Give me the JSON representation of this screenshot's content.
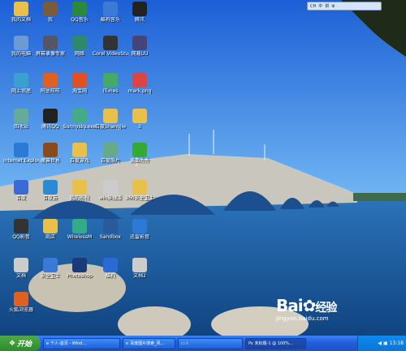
{
  "desktop_icons": [
    {
      "label": "我的文档",
      "glyph": "folder-icon",
      "color": "#e8c04a"
    },
    {
      "label": "我",
      "glyph": "person-icon",
      "color": "#7a5b3a"
    },
    {
      "label": "QQ音乐",
      "glyph": "music-icon",
      "color": "#2a8a3a"
    },
    {
      "label": "酷狗音乐",
      "glyph": "dog-icon",
      "color": "#3b7ad6"
    },
    {
      "label": "腾讯",
      "glyph": "penguin-icon",
      "color": "#222"
    },
    {
      "label": "我的电脑",
      "glyph": "computer-icon",
      "color": "#6b9ad6"
    },
    {
      "label": "屏幕录像专家",
      "glyph": "recorder-icon",
      "color": "#556"
    },
    {
      "label": "网络",
      "glyph": "network-icon",
      "color": "#2a8a6a"
    },
    {
      "label": "Corel VideoStudio",
      "glyph": "video-icon",
      "color": "#333"
    },
    {
      "label": "网易UU",
      "glyph": "game-icon",
      "color": "#447"
    },
    {
      "label": "网上邻居",
      "glyph": "globe-icon",
      "color": "#3aa0d0"
    },
    {
      "label": "阿里旺旺",
      "glyph": "chat-icon",
      "color": "#e06020"
    },
    {
      "label": "淘宝网",
      "glyph": "shop-icon",
      "color": "#e05020"
    },
    {
      "label": "iTunes",
      "glyph": "itunes-icon",
      "color": "#4a6"
    },
    {
      "label": "mark.png",
      "glyph": "image-icon",
      "color": "#d44"
    },
    {
      "label": "回收站",
      "glyph": "recycle-icon",
      "color": "#6a9"
    },
    {
      "label": "腾讯QQ",
      "glyph": "qq-icon",
      "color": "#222"
    },
    {
      "label": "Sunnysky.exe",
      "glyph": "app-icon",
      "color": "#4a8"
    },
    {
      "label": "百度Shangjie",
      "glyph": "folder-icon",
      "color": "#e8c04a"
    },
    {
      "label": "3",
      "glyph": "folder-icon",
      "color": "#e8c04a"
    },
    {
      "label": "Internet Explorer",
      "glyph": "ie-icon",
      "color": "#2a7ad6"
    },
    {
      "label": "魔兽世界",
      "glyph": "warcraft-icon",
      "color": "#8a4a1a"
    },
    {
      "label": "百度游戏",
      "glyph": "folder-icon",
      "color": "#e8c04a"
    },
    {
      "label": "百度照片",
      "glyph": "photo-icon",
      "color": "#6a8"
    },
    {
      "label": "美图秀秀",
      "glyph": "pen-icon",
      "color": "#3a3"
    },
    {
      "label": "百度",
      "glyph": "baidu-icon",
      "color": "#3a6ad6"
    },
    {
      "label": "百度云",
      "glyph": "cloud-icon",
      "color": "#2a8ad6"
    },
    {
      "label": "我的影视",
      "glyph": "folder-icon",
      "color": "#e8c04a"
    },
    {
      "label": "win旗舰版",
      "glyph": "text-icon",
      "color": "#ccc"
    },
    {
      "label": "360安全卫士",
      "glyph": "folder-icon",
      "color": "#e8c04a"
    },
    {
      "label": "QQ影音",
      "glyph": "player-icon",
      "color": "#333"
    },
    {
      "label": "商店",
      "glyph": "folder-icon",
      "color": "#e8c04a"
    },
    {
      "label": "WirelessM",
      "glyph": "wireless-icon",
      "color": "#3a8"
    },
    {
      "label": "Sandbox",
      "glyph": "sandbox-icon",
      "color": "#2a5a9a"
    },
    {
      "label": "迅雷影音",
      "glyph": "thunder-icon",
      "color": "#2a7ad6"
    },
    {
      "label": "文档",
      "glyph": "text-icon",
      "color": "#ccc"
    },
    {
      "label": "安全卫士",
      "glyph": "shield-icon",
      "color": "#3a7ad6"
    },
    {
      "label": "Photoshop",
      "glyph": "ps-icon",
      "color": "#1a3a7a"
    },
    {
      "label": "酷狗",
      "glyph": "k-icon",
      "color": "#2a6ad6"
    },
    {
      "label": "文档2",
      "glyph": "text-icon",
      "color": "#ccc"
    },
    {
      "label": "火狐浏览器",
      "glyph": "firefox-icon",
      "color": "#e06020"
    }
  ],
  "langbar": {
    "items": [
      "CH",
      "中",
      "拼",
      "⚙"
    ]
  },
  "taskbar": {
    "start_label": "开始",
    "tasks": [
      {
        "label": "个人-首页 - Wind..."
      },
      {
        "label": "百度图片搜索_风..."
      },
      {
        "label": "i"
      },
      {
        "label": "未标题-1 @ 100%..."
      }
    ],
    "clock": "13:18"
  },
  "watermark": {
    "brand": "Bai",
    "brand2": "经验",
    "url": "jingyan.baidu.com"
  }
}
